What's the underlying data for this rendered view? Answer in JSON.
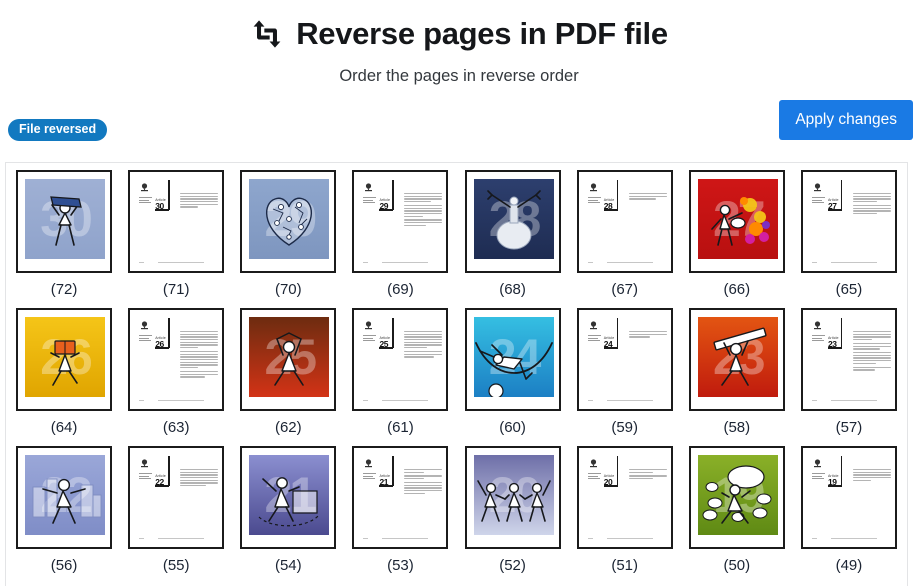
{
  "header": {
    "icon": "reverse-arrows-icon",
    "title": "Reverse pages in PDF file",
    "subtitle": "Order the pages in reverse order"
  },
  "toolbar": {
    "status_badge": "File reversed",
    "apply_button": "Apply changes",
    "badge_color": "#1279c0",
    "button_color": "#1a7ae4"
  },
  "grid": {
    "columns": 8,
    "rows": 3,
    "pages": [
      {
        "label": "(72)",
        "type": "illustration",
        "number": "30",
        "bg_top": "#9fb0d4",
        "bg_bottom": "#8fa3cb",
        "figure": "man-holding-book"
      },
      {
        "label": "(71)",
        "type": "text",
        "article_word": "Article",
        "article_number": "30",
        "paragraphs": [
          6
        ]
      },
      {
        "label": "(70)",
        "type": "illustration",
        "number": "29",
        "bg_top": "#8ea6cd",
        "bg_bottom": "#7e96bf",
        "figure": "heart-of-people"
      },
      {
        "label": "(69)",
        "type": "text",
        "article_word": "Article",
        "article_number": "29",
        "paragraphs": [
          4,
          5,
          3
        ]
      },
      {
        "label": "(68)",
        "type": "illustration",
        "number": "28",
        "bg_top": "#2d3f6e",
        "bg_bottom": "#1e2c52",
        "figure": "globe-balloon"
      },
      {
        "label": "(67)",
        "type": "text",
        "article_word": "Article",
        "article_number": "28",
        "paragraphs": [
          3
        ]
      },
      {
        "label": "(66)",
        "type": "illustration",
        "number": "27",
        "bg_top": "#cf1616",
        "bg_bottom": "#b81010",
        "figure": "painter-with-colors"
      },
      {
        "label": "(65)",
        "type": "text",
        "article_word": "Article",
        "article_number": "27",
        "paragraphs": [
          4,
          4
        ]
      },
      {
        "label": "(64)",
        "type": "illustration",
        "number": "26",
        "bg_top": "#f5c518",
        "bg_bottom": "#e0a500",
        "figure": "person-with-book"
      },
      {
        "label": "(63)",
        "type": "text",
        "article_word": "Article",
        "article_number": "26",
        "paragraphs": [
          7,
          7,
          3
        ]
      },
      {
        "label": "(62)",
        "type": "illustration",
        "number": "25",
        "bg_top": "#6d2c10",
        "bg_bottom": "#d33316",
        "figure": "person-raising-roof"
      },
      {
        "label": "(61)",
        "type": "text",
        "article_word": "Article",
        "article_number": "25",
        "paragraphs": [
          7,
          3
        ]
      },
      {
        "label": "(60)",
        "type": "illustration",
        "number": "24",
        "bg_top": "#35bfe2",
        "bg_bottom": "#1c7fc4",
        "figure": "person-in-hammock"
      },
      {
        "label": "(59)",
        "type": "text",
        "article_word": "Article",
        "article_number": "24",
        "paragraphs": [
          3
        ]
      },
      {
        "label": "(58)",
        "type": "illustration",
        "number": "23",
        "bg_top": "#e35512",
        "bg_bottom": "#c01b0d",
        "figure": "person-carrying-plank"
      },
      {
        "label": "(57)",
        "type": "text",
        "article_word": "Article",
        "article_number": "23",
        "paragraphs": [
          4,
          3,
          5,
          2
        ]
      },
      {
        "label": "(56)",
        "type": "illustration",
        "number": "22",
        "bg_top": "#9aa7d8",
        "bg_bottom": "#7f8dc7",
        "figure": "person-in-city"
      },
      {
        "label": "(55)",
        "type": "text",
        "article_word": "Article",
        "article_number": "22",
        "paragraphs": [
          7
        ]
      },
      {
        "label": "(54)",
        "type": "illustration",
        "number": "21",
        "bg_top": "#8b8fd0",
        "bg_bottom": "#4b4a8f",
        "figure": "person-voting"
      },
      {
        "label": "(53)",
        "type": "text",
        "article_word": "Article",
        "article_number": "21",
        "paragraphs": [
          2,
          2,
          5
        ]
      },
      {
        "label": "(52)",
        "type": "illustration",
        "number": "20",
        "bg_top": "#6e6fa8",
        "bg_bottom": "#cfd5ea",
        "figure": "three-people-joined"
      },
      {
        "label": "(51)",
        "type": "text",
        "article_word": "Article",
        "article_number": "20",
        "paragraphs": [
          2,
          2
        ]
      },
      {
        "label": "(50)",
        "type": "illustration",
        "number": "19",
        "bg_top": "#8ab028",
        "bg_bottom": "#5f8a14",
        "figure": "person-speech-bubbles"
      },
      {
        "label": "(49)",
        "type": "text",
        "article_word": "Article",
        "article_number": "19",
        "paragraphs": [
          5
        ]
      }
    ]
  }
}
